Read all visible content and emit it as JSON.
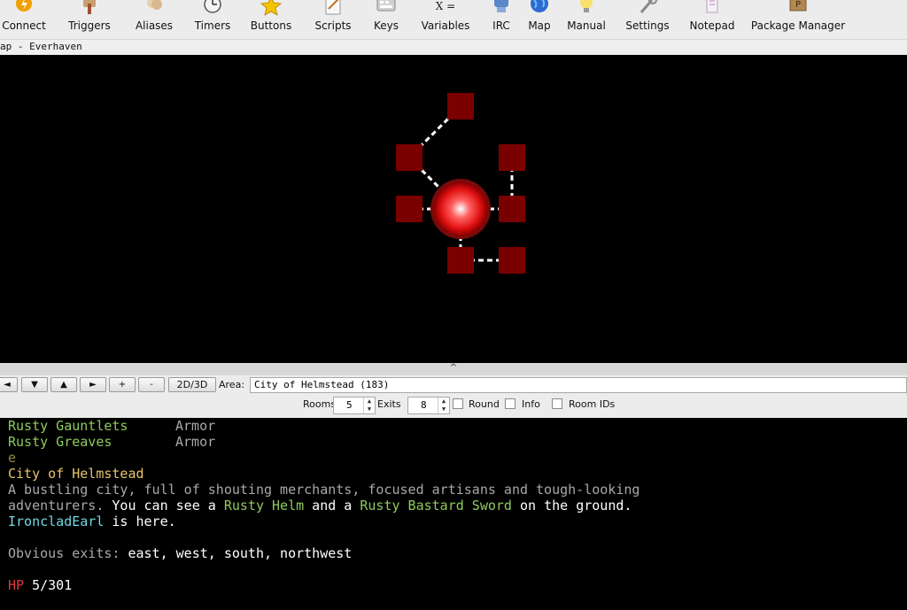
{
  "toolbar": {
    "items": [
      {
        "label": "Connect",
        "icon": "connect-icon"
      },
      {
        "label": "Triggers",
        "icon": "triggers-icon"
      },
      {
        "label": "Aliases",
        "icon": "aliases-icon"
      },
      {
        "label": "Timers",
        "icon": "timers-icon"
      },
      {
        "label": "Buttons",
        "icon": "star-icon"
      },
      {
        "label": "Scripts",
        "icon": "scripts-icon"
      },
      {
        "label": "Keys",
        "icon": "keys-icon"
      },
      {
        "label": "Variables",
        "icon": "variables-icon"
      },
      {
        "label": "IRC",
        "icon": "irc-icon"
      },
      {
        "label": "Map",
        "icon": "globe-icon"
      },
      {
        "label": "Manual",
        "icon": "lightbulb-icon"
      },
      {
        "label": "Settings",
        "icon": "settings-icon"
      },
      {
        "label": "Notepad",
        "icon": "notepad-icon"
      },
      {
        "label": "Package Manager",
        "icon": "package-icon"
      }
    ],
    "variables_glyph": "X ="
  },
  "map_title": "ap - Everhaven",
  "splitter_glyph": "^",
  "map_controls": {
    "nav": [
      "◄",
      "▼",
      "▲",
      "►",
      "+",
      "-"
    ],
    "toggle_label": "2D/3D",
    "area_label": "Area:",
    "area_value": "City of Helmstead (183)",
    "rooms_label": "Rooms",
    "rooms_value": "5",
    "exits_label": "Exits",
    "exits_value": "8",
    "round_label": "Round",
    "info_label": "Info",
    "room_ids_label": "Room IDs"
  },
  "console": {
    "item1_name": "Rusty Gauntlets",
    "item1_type": "Armor",
    "item2_name": "Rusty Greaves",
    "item2_type": "Armor",
    "command": "e",
    "room_name": "City of Helmstead",
    "desc_line1": "A bustling city, full of shouting merchants, focused artisans and tough-looking",
    "desc_line2_a": "adventurers.",
    "desc_line2_b": " You can see a ",
    "desc_line2_c": "Rusty Helm",
    "desc_line2_d": " and a ",
    "desc_line2_e": "Rusty Bastard Sword",
    "desc_line2_f": " on the ground.",
    "player_name": "IroncladEarl",
    "player_suffix": " is here.",
    "exits_prefix": "Obvious exits: ",
    "exits_list": "east, west, south, northwest",
    "hp_label": "HP",
    "hp_value": " 5/301"
  },
  "colors": {
    "room_fill": "#7a0000",
    "player_marker": "#ff2020",
    "exit_line": "#ffffff"
  }
}
